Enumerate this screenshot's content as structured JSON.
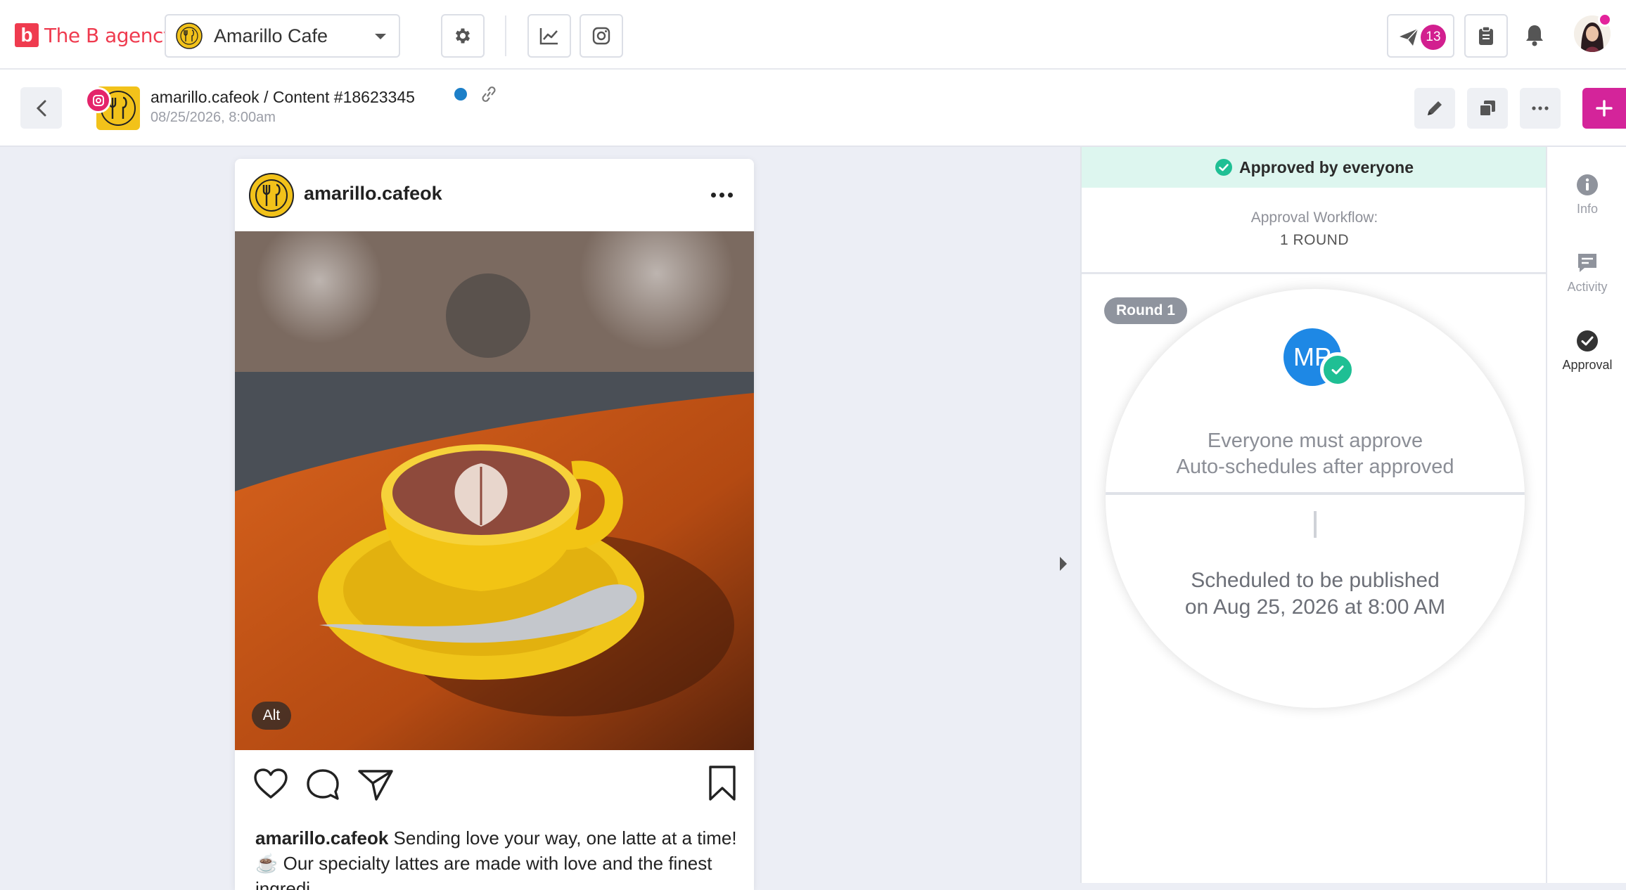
{
  "app": {
    "logo_mark": "b",
    "logo_text": "The B agency",
    "brand_selector": {
      "selected": "Amarillo Cafe"
    },
    "notifications_count": "13"
  },
  "content": {
    "title": "amarillo.cafeok / Content #18623345",
    "date": "08/25/2026, 8:00am",
    "status_color": "#1c7fc8"
  },
  "preview": {
    "username": "amarillo.cafeok",
    "alt_label": "Alt",
    "caption_user": "amarillo.cafeok",
    "caption_text": "Sending love your way, one latte at a time! ☕ Our specialty lattes are made with love and the finest ingredi"
  },
  "approval": {
    "banner": "Approved by everyone",
    "workflow_label": "Approval Workflow:",
    "workflow_rounds": "1 ROUND",
    "round_label": "Round 1",
    "approver_initials": "MP",
    "rule_line1": "Everyone must approve",
    "rule_line2": "Auto-schedules after approved",
    "schedule_line1": "Scheduled to be published",
    "schedule_line2": "on Aug 25, 2026 at 8:00 AM"
  },
  "rail": {
    "items": [
      {
        "label": "Info",
        "icon": "info-icon"
      },
      {
        "label": "Activity",
        "icon": "activity-icon"
      },
      {
        "label": "Approval",
        "icon": "approval-icon",
        "active": true
      }
    ]
  },
  "colors": {
    "brand": "#ef3b4f",
    "accent": "#d4249a",
    "approved_bg": "#ddf6ef",
    "approved_check": "#1fbf94"
  }
}
